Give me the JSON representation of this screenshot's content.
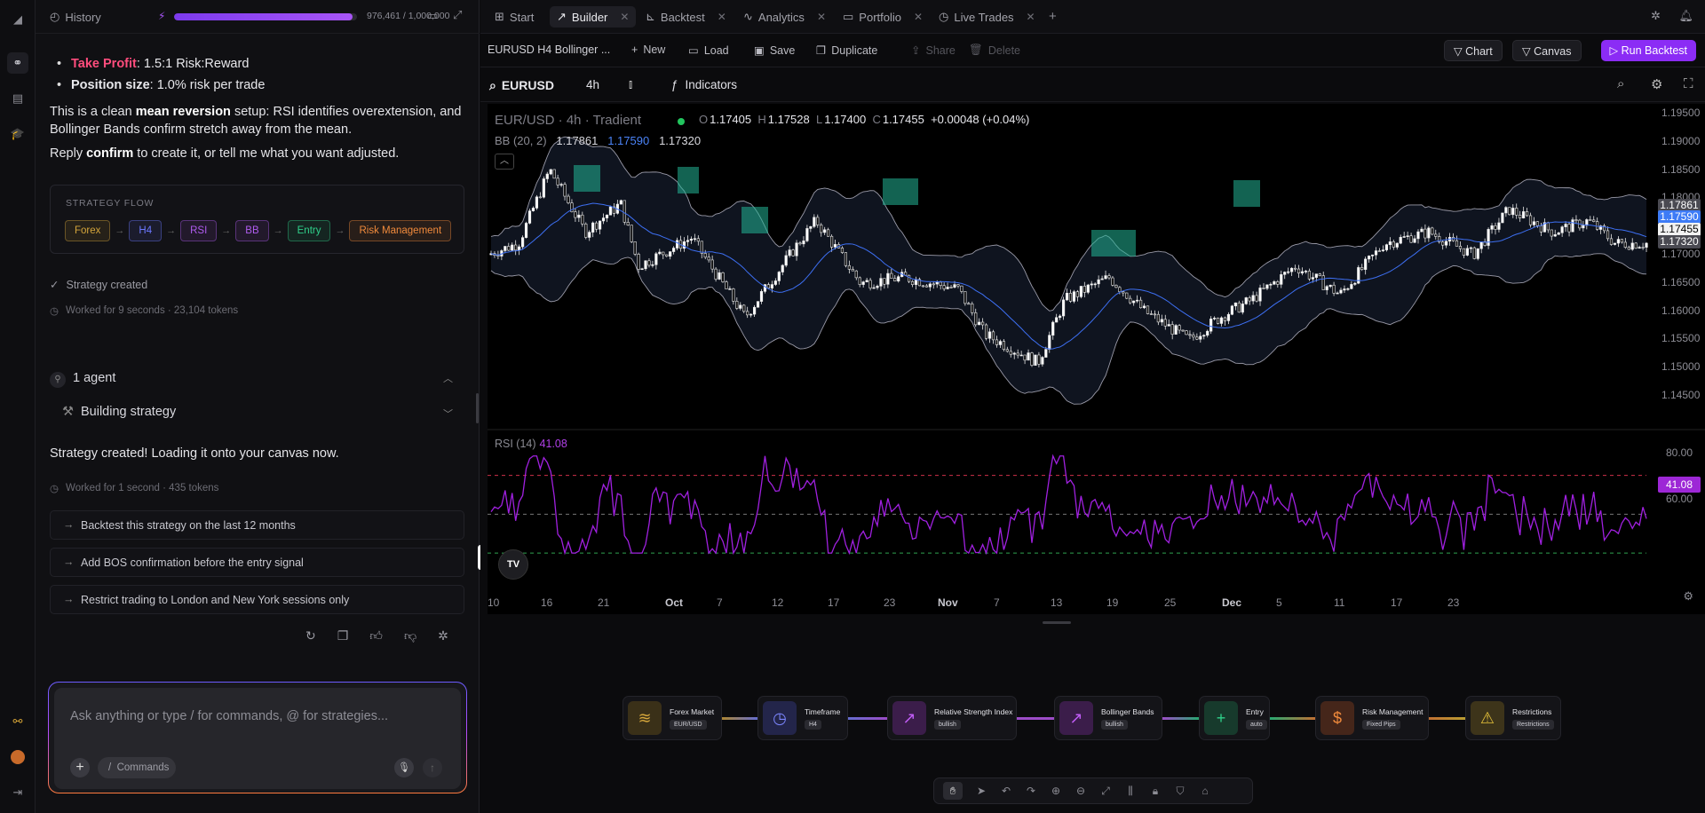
{
  "rail": {
    "icons": [
      "app-logo-icon",
      "builder-icon",
      "document-icon",
      "graduation-icon",
      "link-icon",
      "avatar",
      "logout-icon"
    ]
  },
  "chat": {
    "history_label": "History",
    "credits_text": "976,461 / 1,000,000",
    "credits_fraction": 0.976,
    "bullets": [
      {
        "label": "Take Profit",
        "text": ": 1.5:1 Risk:Reward"
      },
      {
        "label": "Position size",
        "text": ": 1.0% risk per trade"
      }
    ],
    "para1_a": "This is a clean ",
    "para1_b": "mean reversion",
    "para1_c": " setup: RSI identifies overextension, and Bollinger Bands confirm stretch away from the mean.",
    "para2_a": "Reply ",
    "para2_b": "confirm",
    "para2_c": " to create it, or tell me what you want adjusted.",
    "flow_title": "STRATEGY FLOW",
    "flow_chips": [
      {
        "label": "Forex",
        "color": "#d4a53b"
      },
      {
        "label": "H4",
        "color": "#6b78ff"
      },
      {
        "label": "RSI",
        "color": "#b05cf0"
      },
      {
        "label": "BB",
        "color": "#b05cf0"
      },
      {
        "label": "Entry",
        "color": "#2fd08a"
      },
      {
        "label": "Risk Management",
        "color": "#f08a3c"
      }
    ],
    "strategy_created": "Strategy created",
    "worked1": "Worked for 9 seconds · 23,104 tokens",
    "agents_label": "1 agent",
    "building_label": "Building strategy",
    "created_msg": "Strategy created! Loading it onto your canvas now.",
    "worked2": "Worked for 1 second · 435 tokens",
    "suggestions": [
      "Backtest this strategy on the last 12 months",
      "Add BOS confirmation before the entry signal",
      "Restrict trading to London and New York sessions only"
    ],
    "input_placeholder": "Ask anything or type / for commands, @ for strategies...",
    "commands_label": "Commands"
  },
  "tabs": [
    {
      "label": "Start",
      "icon": "grid-icon"
    },
    {
      "label": "Builder",
      "icon": "trend-icon"
    },
    {
      "label": "Backtest",
      "icon": "chart-icon"
    },
    {
      "label": "Analytics",
      "icon": "pulse-icon"
    },
    {
      "label": "Portfolio",
      "icon": "folder-icon"
    },
    {
      "label": "Live Trades",
      "icon": "clock-icon"
    }
  ],
  "toolbar": {
    "title": "EURUSD H4 Bollinger ...",
    "new": "New",
    "load": "Load",
    "save": "Save",
    "duplicate": "Duplicate",
    "share": "Share",
    "delete": "Delete",
    "chart": "Chart",
    "canvas": "Canvas",
    "run": "Run Backtest"
  },
  "chart_tb": {
    "symbol": "EURUSD",
    "timeframe": "4h",
    "indicators": "Indicators"
  },
  "chart": {
    "legend_title": "EUR/USD · 4h · Tradient",
    "o": "1.17405",
    "h": "1.17528",
    "l": "1.17400",
    "c": "1.17455",
    "chg": "+0.00048 (+0.04%)",
    "bb_label": "BB (20, 2)",
    "bb_upper": "1.17861",
    "bb_mid": "1.17590",
    "bb_lower": "1.17320",
    "rsi_label": "RSI (14)",
    "rsi_val": "41.08",
    "price_ticks": [
      "1.19500",
      "1.19000",
      "1.18500",
      "1.18000",
      "1.17500",
      "1.17000",
      "1.16500",
      "1.16000",
      "1.15500",
      "1.15000",
      "1.14500"
    ],
    "rsi_ticks": [
      "80.00",
      "60.00"
    ],
    "x_ticks": [
      "10",
      "16",
      "21",
      "Oct",
      "7",
      "12",
      "17",
      "23",
      "Nov",
      "7",
      "13",
      "19",
      "25",
      "Dec",
      "5",
      "11",
      "17",
      "23"
    ],
    "last_price": "1.17455"
  },
  "chart_data": {
    "type": "line",
    "title": "EUR/USD · 4h · Tradient",
    "series": [
      {
        "name": "RSI (14)",
        "last": 41.08
      },
      {
        "name": "BB (20, 2)",
        "values": [
          1.17861,
          1.1759,
          1.1732
        ]
      }
    ],
    "ylim": [
      1.145,
      1.195
    ],
    "rsi_levels": [
      70,
      50,
      30
    ]
  },
  "nodes": [
    {
      "title": "Forex Market",
      "badge": "EUR/USD",
      "color": "#d4a53b",
      "bg": "#3a3018",
      "glyph": "≋"
    },
    {
      "title": "Timeframe",
      "badge": "H4",
      "color": "#7c86ff",
      "bg": "#23254a",
      "glyph": "◷"
    },
    {
      "title": "Relative Strength Index",
      "badge": "bullish",
      "color": "#c05cf5",
      "bg": "#3b1d4a",
      "glyph": "↗"
    },
    {
      "title": "Bollinger Bands",
      "badge": "bullish",
      "color": "#c05cf5",
      "bg": "#3b1d4a",
      "glyph": "↗"
    },
    {
      "title": "Entry",
      "badge": "auto",
      "color": "#2fd08a",
      "bg": "#173a2c",
      "glyph": "+"
    },
    {
      "title": "Risk Management",
      "badge": "Fixed Pips",
      "color": "#f08a3c",
      "bg": "#45261a",
      "glyph": "$"
    },
    {
      "title": "Restrictions",
      "badge": "Restrictions",
      "color": "#e6c23a",
      "bg": "#3d341a",
      "glyph": "⚠"
    }
  ]
}
